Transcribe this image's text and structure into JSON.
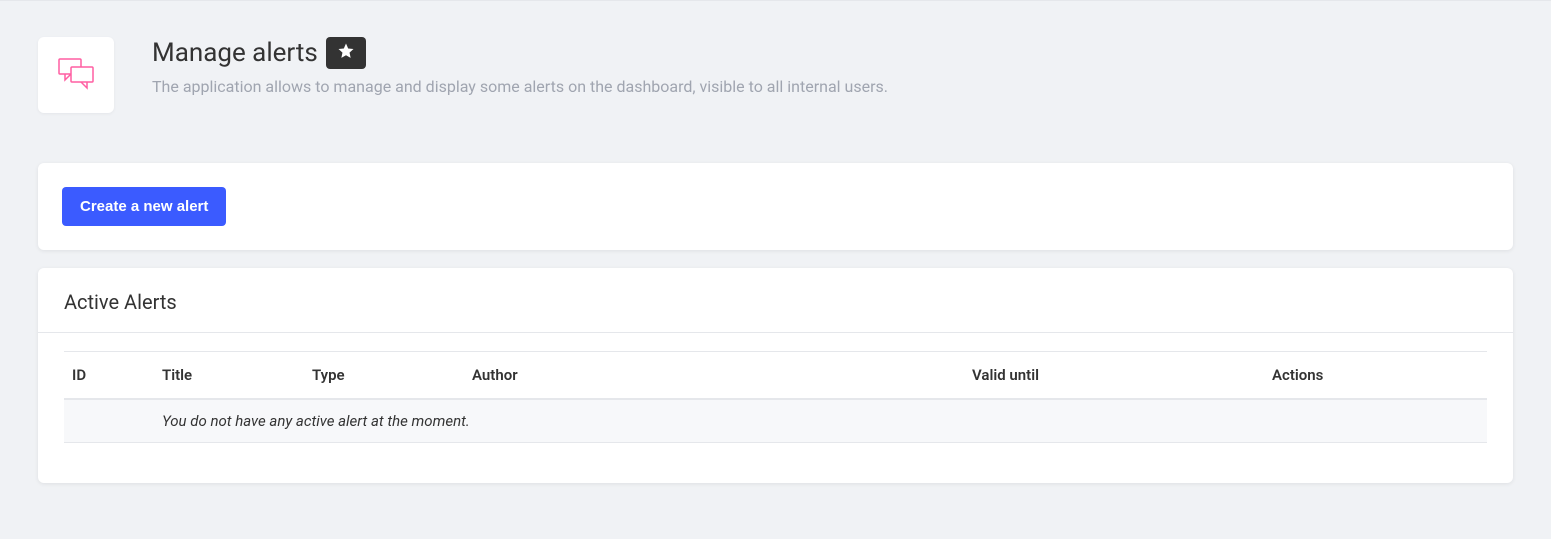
{
  "header": {
    "title": "Manage alerts",
    "description": "The application allows to manage and display some alerts on the dashboard, visible to all internal users."
  },
  "actions": {
    "create_label": "Create a new alert"
  },
  "table": {
    "section_title": "Active Alerts",
    "columns": {
      "id": "ID",
      "title": "Title",
      "type": "Type",
      "author": "Author",
      "valid_until": "Valid until",
      "actions": "Actions"
    },
    "empty_message": "You do not have any active alert at the moment."
  }
}
